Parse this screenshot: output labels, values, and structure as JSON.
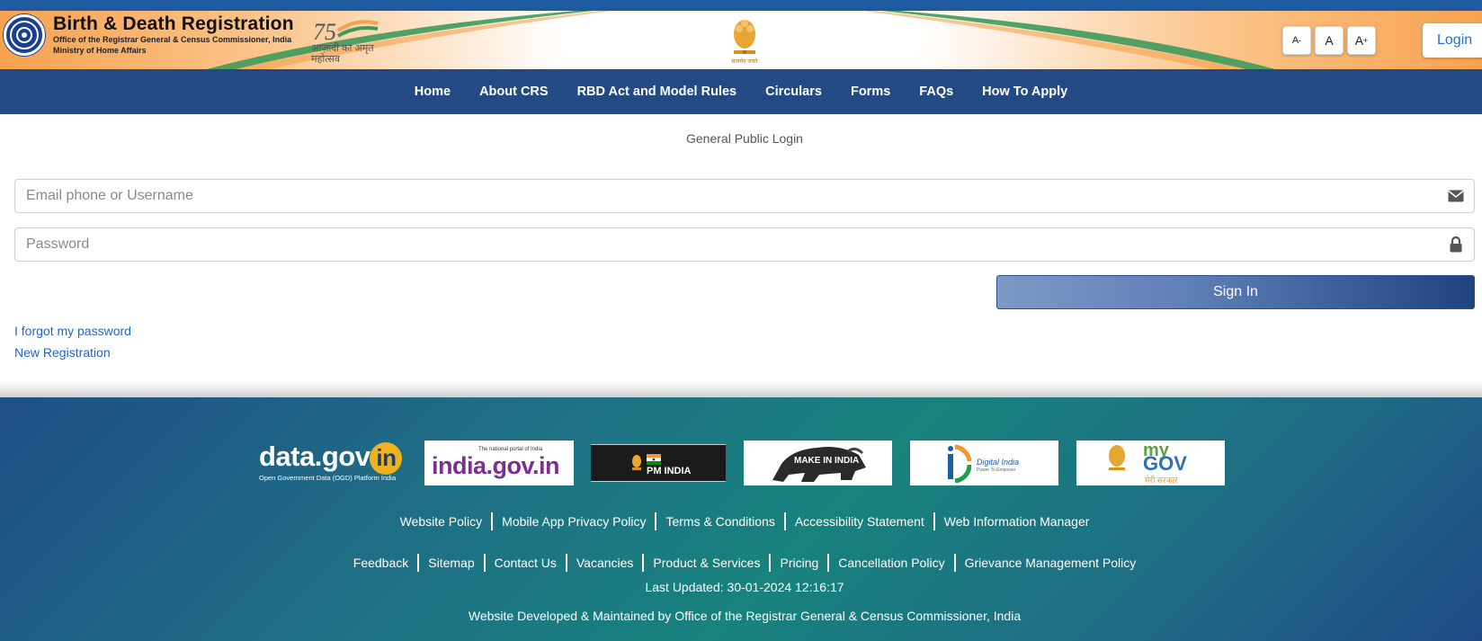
{
  "header": {
    "title": "Birth & Death Registration",
    "subtitle1": "Office of the Registrar General & Census Commissioner, India",
    "subtitle2": "Ministry of Home Affairs",
    "azadi_text": "आज़ादी का अमृत महोत्सव",
    "azadi_number": "75",
    "emblem_motto": "सत्यमेव जयते",
    "font_decrease": "A",
    "font_decrease_sup": "-",
    "font_normal": "A",
    "font_increase": "A",
    "font_increase_sup": "+",
    "login_label": "Login"
  },
  "nav": {
    "items": [
      "Home",
      "About CRS",
      "RBD Act and Model Rules",
      "Circulars",
      "Forms",
      "FAQs",
      "How To Apply"
    ]
  },
  "form": {
    "title": "General Public Login",
    "username_placeholder": "Email phone or Username",
    "password_placeholder": "Password",
    "signin_label": "Sign In",
    "forgot_label": "I forgot my password",
    "register_label": "New Registration"
  },
  "footer": {
    "logos": {
      "datagov_main": "data.gov",
      "datagov_in": "in",
      "datagov_sub": "Open Government Data (OGD) Platform India",
      "indiagov_tag": "The national portal of India",
      "indiagov_main": "india.gov.in",
      "pmindia": "PM INDIA",
      "makeinindia": "MAKE IN INDIA",
      "digitalindia": "Digital India",
      "digitalindia_sub": "Power To Empower",
      "mygov_my": "my",
      "mygov_gov": "GOV",
      "mygov_sub": "मेरी सरकार"
    },
    "links_row1": [
      "Website Policy",
      "Mobile App Privacy Policy",
      "Terms & Conditions",
      "Accessibility Statement",
      "Web Information Manager"
    ],
    "links_row2": [
      "Feedback",
      "Sitemap",
      "Contact Us",
      "Vacancies",
      "Product & Services",
      "Pricing",
      "Cancellation Policy",
      "Grievance Management Policy"
    ],
    "last_updated": "Last Updated: 30-01-2024 12:16:17",
    "developed_by": "Website Developed & Maintained by Office of the Registrar General & Census Commissioner, India"
  },
  "colors": {
    "nav_bg": "#234a83",
    "link": "#1f66c8",
    "topbar": "#1e5a9f",
    "footer_teal": "#18827d"
  },
  "icons": {
    "username_field": "envelope-icon",
    "password_field": "lock-icon"
  }
}
